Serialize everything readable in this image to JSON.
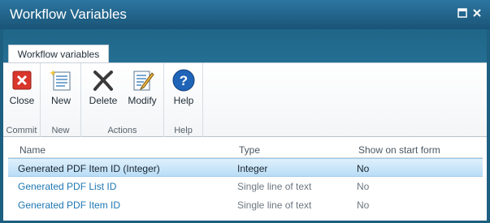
{
  "window": {
    "title": "Workflow Variables",
    "maximize_icon": "maximize-icon",
    "close_icon": "close-window-icon"
  },
  "ribbon": {
    "tab": "Workflow variables",
    "groups": [
      {
        "label": "Commit",
        "buttons": [
          {
            "label": "Close",
            "icon": "close-red-x-icon"
          }
        ]
      },
      {
        "label": "New",
        "buttons": [
          {
            "label": "New",
            "icon": "new-document-icon"
          }
        ]
      },
      {
        "label": "Actions",
        "buttons": [
          {
            "label": "Delete",
            "icon": "delete-x-icon"
          },
          {
            "label": "Modify",
            "icon": "modify-pencil-icon"
          }
        ]
      },
      {
        "label": "Help",
        "buttons": [
          {
            "label": "Help",
            "icon": "help-question-icon"
          }
        ]
      }
    ]
  },
  "table": {
    "columns": [
      "Name",
      "Type",
      "Show on start form"
    ],
    "rows": [
      {
        "name": "Generated PDF Item ID (Integer)",
        "type": "Integer",
        "show": "No",
        "selected": true
      },
      {
        "name": "Generated PDF List ID",
        "type": "Single line of text",
        "show": "No",
        "selected": false
      },
      {
        "name": "Generated PDF Item ID",
        "type": "Single line of text",
        "show": "No",
        "selected": false
      }
    ]
  },
  "colors": {
    "titlebar": "#1a5477",
    "link": "#1c77b2",
    "selection": "#b9ddf6",
    "close_red": "#d9362c",
    "help_blue": "#1f64b7"
  }
}
